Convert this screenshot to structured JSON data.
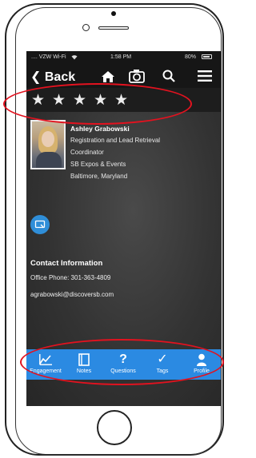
{
  "status": {
    "carrier": ".... VZW Wi-Fi",
    "time": "1:58 PM",
    "battery": "80%"
  },
  "nav": {
    "back_label": "Back",
    "icons": [
      "home-icon",
      "camera-icon",
      "search-icon",
      "menu-icon"
    ]
  },
  "rating": {
    "stars_total": 5,
    "stars_filled": 0
  },
  "profile": {
    "name": "Ashley Grabowski",
    "title_line1": "Registration and Lead Retrieval",
    "title_line2": "Coordinator",
    "company": "SB Expos & Events",
    "location": "Baltimore, Maryland"
  },
  "contact": {
    "section_title": "Contact Information",
    "phone": "Office Phone: 301-363-4809",
    "email": "agrabowski@discoversb.com"
  },
  "tabs": [
    {
      "label": "Engagement",
      "icon": "chart-icon"
    },
    {
      "label": "Notes",
      "icon": "notes-icon"
    },
    {
      "label": "Questions",
      "icon": "question-icon"
    },
    {
      "label": "Tags",
      "icon": "check-icon"
    },
    {
      "label": "Profile",
      "icon": "profile-icon"
    }
  ],
  "colors": {
    "accent": "#2b8ae2",
    "highlight": "#e2121f",
    "screen_bg": "#333333"
  }
}
